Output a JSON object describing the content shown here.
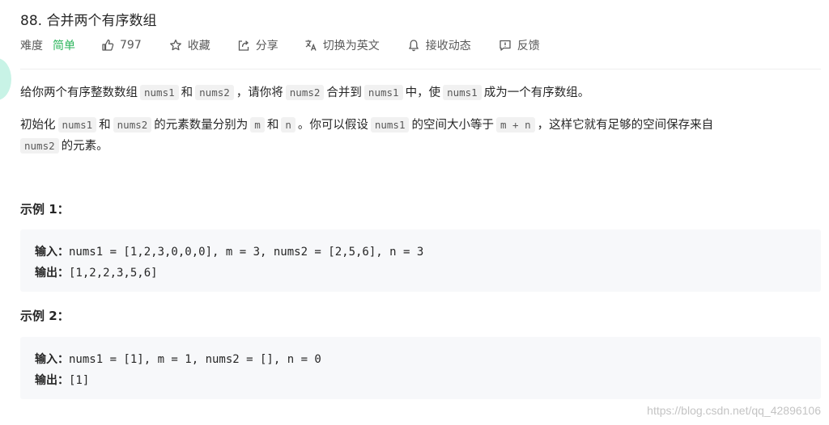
{
  "problem": {
    "title": "88. 合并两个有序数组"
  },
  "meta": {
    "difficulty_label": "难度",
    "difficulty_value": "简单",
    "likes": "797",
    "favorite": "收藏",
    "share": "分享",
    "translate": "切换为英文",
    "subscribe": "接收动态",
    "feedback": "反馈",
    "difficulty_color": "#2db55d"
  },
  "description": {
    "p1": [
      "给你两个有序整数数组",
      "nums1",
      "和",
      "nums2",
      "，请你将",
      "nums2",
      "合并到",
      "nums1",
      "中",
      "，使",
      "nums1",
      "成为一个有序数组。"
    ],
    "p2": [
      "初始化",
      "nums1",
      "和",
      "nums2",
      "的元素数量分别为",
      "m",
      "和",
      "n",
      "。你可以假设",
      "nums1",
      "的空间大小等于",
      "m + n",
      "，这样它就有足够的空间保存来自"
    ],
    "p3": [
      "nums2",
      "的元素。"
    ]
  },
  "examples": [
    {
      "title": "示例 1：",
      "input_label": "输入：",
      "input": "nums1 = [1,2,3,0,0,0], m = 3, nums2 = [2,5,6], n = 3",
      "output_label": "输出：",
      "output": "[1,2,2,3,5,6]"
    },
    {
      "title": "示例 2：",
      "input_label": "输入：",
      "input": "nums1 = [1], m = 1, nums2 = [], n = 0",
      "output_label": "输出：",
      "output": "[1]"
    }
  ],
  "watermark": "https://blog.csdn.net/qq_42896106"
}
